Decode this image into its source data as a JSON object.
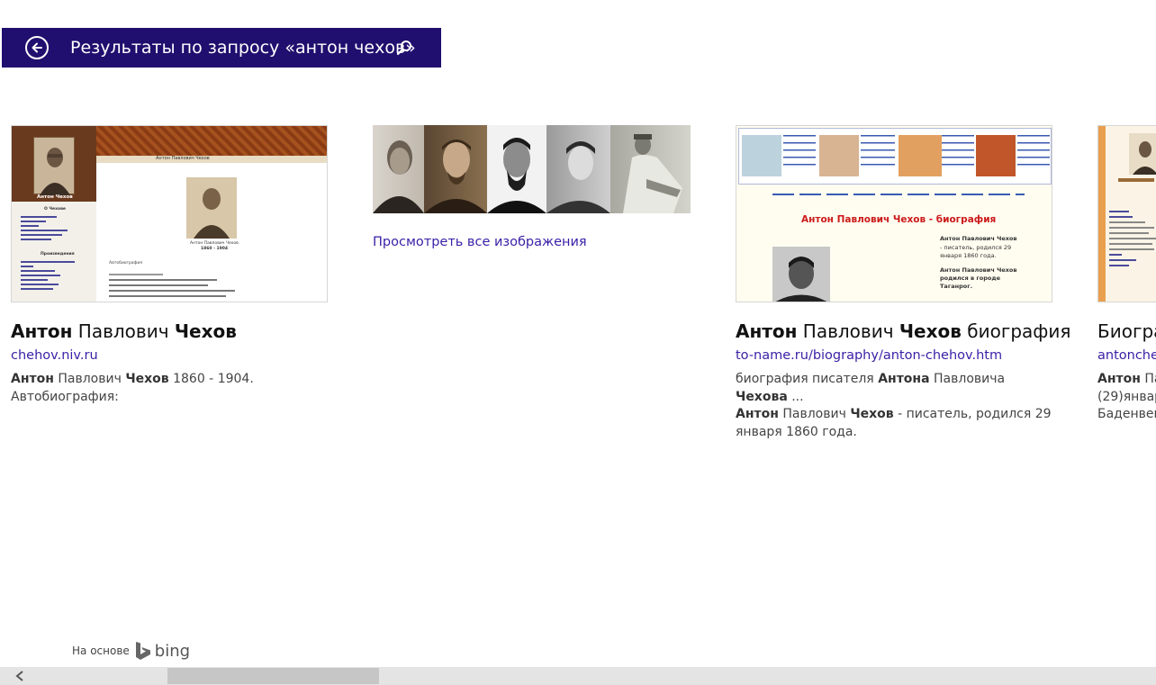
{
  "header": {
    "title": "Результаты по запросу «антон чехов»",
    "back_icon": "back-arrow-circle-icon",
    "search_icon": "search-icon",
    "bg_color": "#200f6e"
  },
  "images": {
    "view_all_label": "Просмотреть все изображения",
    "count": 5
  },
  "results": [
    {
      "title_parts": [
        {
          "text": "Антон",
          "bold": true
        },
        {
          "text": " Павлович ",
          "bold": false
        },
        {
          "text": "Чехов",
          "bold": true
        }
      ],
      "url": "chehov.niv.ru",
      "snippet_html": "<b>Антон</b> Павлович <b>Чехов</b> 1860 - 1904. Автобиография:"
    },
    {
      "title_parts": [
        {
          "text": "Антон",
          "bold": true
        },
        {
          "text": " Павлович ",
          "bold": false
        },
        {
          "text": "Чехов",
          "bold": true
        },
        {
          "text": " биография",
          "bold": false
        }
      ],
      "url": "to-name.ru/biography/anton-chehov.htm",
      "snippet_html": "биография писателя <b>Антона</b> Павловича <b>Чехова</b> ...<br><b>Антон</b> Павлович <b>Чехов</b> - писатель, родился 29<br>января 1860 года."
    },
    {
      "title_parts": [
        {
          "text": "Биогра",
          "bold": false
        }
      ],
      "url": "antonchek",
      "snippet_html": "<b>Антон</b> Па<br>(29)январ<br>Баденвей"
    }
  ],
  "thumbs": {
    "chehov_site": {
      "page_title": "Антон Павлович Чехов",
      "portrait_caption": "Антон Чехов",
      "dates": "1860 - 1904",
      "menu_heading": "О Чехове",
      "works_heading": "Произведения",
      "autobio": "Автобиография"
    },
    "toname_site": {
      "headline": "Антон Павлович Чехов - биография",
      "intro_name": "Антон Павлович Чехов",
      "intro_text": "- писатель, родился 29 января 1860 года.",
      "born_text": "Антон Павлович Чехов родился в городе Таганрог."
    }
  },
  "footer": {
    "powered_label": "На основе",
    "brand": "bing"
  },
  "scrollbar": {
    "left_arrow_icon": "chevron-left-icon",
    "position_fraction": 0.16
  }
}
